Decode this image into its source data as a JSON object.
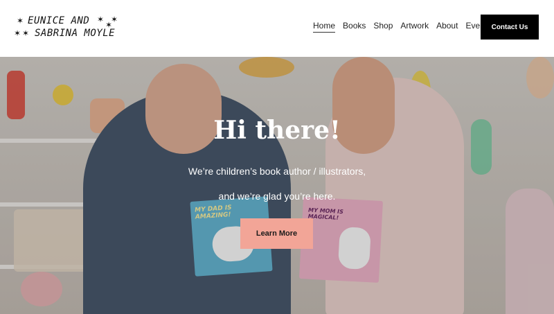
{
  "brand": {
    "line1": "EUNICE AND",
    "line2": "SABRINA MOYLE"
  },
  "nav": {
    "items": [
      "Home",
      "Books",
      "Shop",
      "Artwork",
      "About",
      "Events"
    ],
    "active": "Home"
  },
  "header": {
    "contact_label": "Contact Us"
  },
  "hero": {
    "title": "Hi there!",
    "subtitle_line1": "We’re children’s book author / illustrators,",
    "subtitle_line2": "and we’re glad you’re here.",
    "cta_label": "Learn More"
  },
  "books": {
    "left_title": "MY DAD IS AMAZING!",
    "right_title": "MY MOM IS MAGICAL!"
  },
  "colors": {
    "cta": "#f2a597",
    "contact_bg": "#000000",
    "hero_text": "#ffffff"
  }
}
